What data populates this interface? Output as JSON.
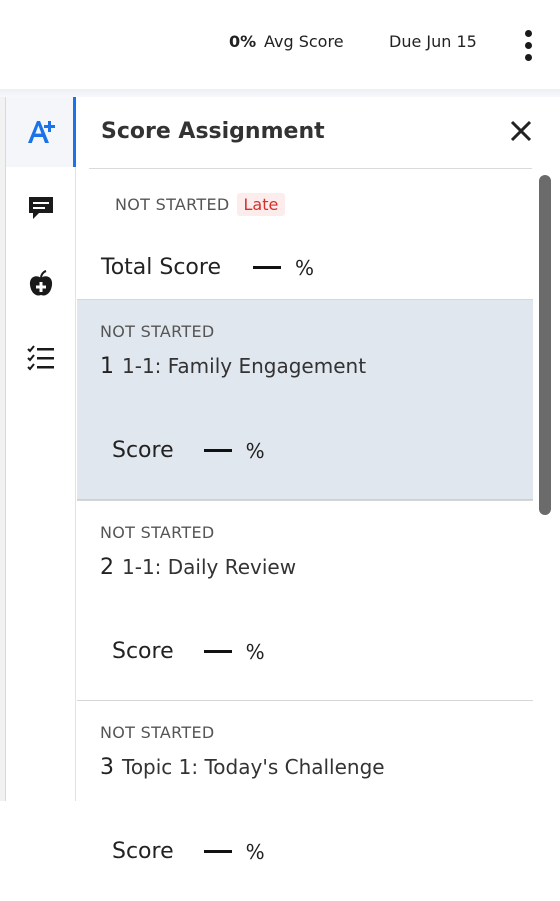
{
  "header": {
    "avg_score_value": "0%",
    "avg_score_label": "Avg Score",
    "due": "Due Jun 15",
    "menu_icon": "kebab-menu-icon"
  },
  "rail": {
    "items": [
      {
        "name": "score-assignment",
        "icon": "a-plus-icon",
        "active": true
      },
      {
        "name": "comments",
        "icon": "comment-icon",
        "active": false
      },
      {
        "name": "add-apple",
        "icon": "apple-plus-icon",
        "active": false
      },
      {
        "name": "checklist",
        "icon": "checklist-icon",
        "active": false
      }
    ]
  },
  "panel": {
    "title": "Score Assignment",
    "status": "NOT STARTED",
    "late_badge": "Late",
    "total_label": "Total Score",
    "total_pct": "%",
    "items": [
      {
        "status": "NOT STARTED",
        "number": "1",
        "name": "1-1: Family Engagement",
        "score_label": "Score",
        "pct": "%",
        "selected": true
      },
      {
        "status": "NOT STARTED",
        "number": "2",
        "name": "1-1: Daily Review",
        "score_label": "Score",
        "pct": "%",
        "selected": false
      },
      {
        "status": "NOT STARTED",
        "number": "3",
        "name": "Topic 1: Today's Challenge",
        "score_label": "Score",
        "pct": "%",
        "selected": false
      }
    ]
  },
  "colors": {
    "accent": "#1a73e8",
    "late": "#d0312d",
    "selected_bg": "#e0e7ef"
  }
}
